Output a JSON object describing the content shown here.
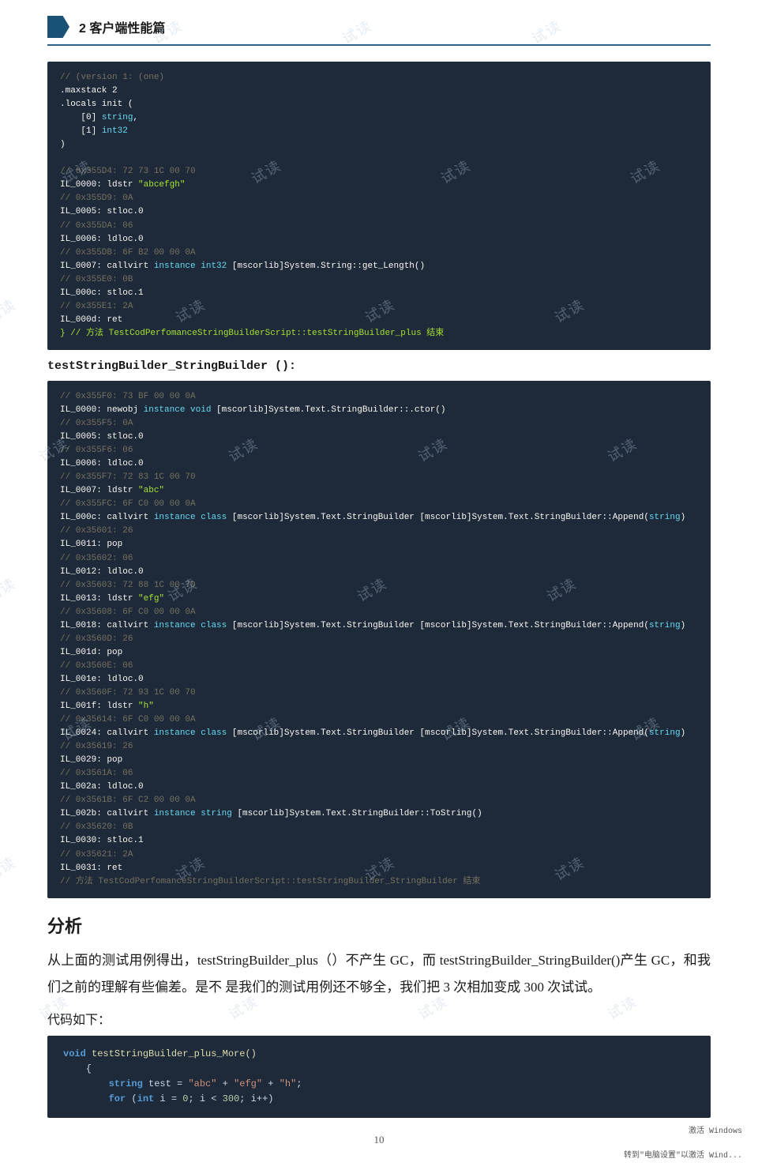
{
  "chapter": {
    "number": "2",
    "title": "2 客户端性能篇"
  },
  "code_block_1": {
    "lines": [
      "// (version 1: (one)",
      ".maxstack 2",
      ".locals init (",
      "    [0] string,",
      "    [1] int32",
      ")",
      "",
      "// 0x355D4: 72 73 1C 00 70",
      "IL_0000: ldstr \"abcefgh\"",
      "// 0x355D9: 0A",
      "IL_0005: stloc.0",
      "// 0x355DA: 06",
      "IL_0006: ldloc.0",
      "// 0x355DB: 6F B2 00 00 0A",
      "IL_0007: callvirt instance int32 [mscorlib]System.String::get_Length()",
      "// 0x355E0: 0B",
      "IL_000c: stloc.1",
      "// 0x355E1: 2A",
      "IL_000d: ret",
      "} // 方法 TestCodPerfomanceStringBuilderScript::testStringBuilder_plus 结束"
    ]
  },
  "method_header_2": "testStringBuilder_StringBuilder ():",
  "code_block_2": {
    "lines": [
      "// 0x355F0: 73 BF 00 00 0A",
      "IL_0000: newobj instance void [mscorlib]System.Text.StringBuilder::.ctor()",
      "// 0x355F5: 0A",
      "IL_0005: stloc.0",
      "// 0x355F6: 06",
      "IL_0006: ldloc.0",
      "// 0x355F7: 72 83 1C 00 70",
      "IL_0007: ldstr \"abc\"",
      "// 0x355FC: 6F C0 00 00 0A",
      "IL_000c: callvirt instance class [mscorlib]System.Text.StringBuilder [mscorlib]System.Text.StringBuilder::Append(string)",
      "// 0x35601: 26",
      "IL_0011: pop",
      "// 0x35602: 06",
      "IL_0012: ldloc.0",
      "// 0x35603: 72 88 1C 00 70",
      "IL_0013: ldstr \"efg\"",
      "// 0x35608: 6F C0 00 00 0A",
      "IL_0018: callvirt instance class [mscorlib]System.Text.StringBuilder [mscorlib]System.Text.StringBuilder::Append(string)",
      "// 0x3560D: 26",
      "IL_001d: pop",
      "// 0x3560E: 06",
      "IL_001e: ldloc.0",
      "// 0x3560F: 72 93 1C 00 70",
      "IL_001f: ldstr \"h\"",
      "// 0x35614: 6F C0 00 00 0A",
      "IL_0024: callvirt instance class [mscorlib]System.Text.StringBuilder [mscorlib]System.Text.StringBuilder::Append(string)",
      "// 0x35619: 26",
      "IL_0029: pop",
      "// 0x3561A: 06",
      "IL_002a: ldloc.0",
      "// 0x3561B: 6F C2 00 00 0A",
      "IL_002b: callvirt instance string [mscorlib]System.Text.StringBuilder::ToString()",
      "// 0x35620: 0B",
      "IL_0030: stloc.1",
      "// 0x35621: 2A",
      "IL_0031: ret",
      "// 方法 TestCodPerfomanceStringBuilderScript::testStringBuilder_StringBuilder 结束"
    ]
  },
  "section_analysis": "分析",
  "analysis_text": "从上面的测试用例得出，testStringBuilder_plus（）不产生 GC，而 testStringBuilder_StringBuilder()产生 GC，和我们之前的理解有些偏差。是不是我们的测试用例还不够全，我们把 3 次相加变成 300 次试试。",
  "label_code": "代码如下：",
  "code_block_3": {
    "keyword_void": "void",
    "func_name": "testStringBuilder_plus_More()",
    "body_lines": [
      "{",
      "        string test = \"abc\" + \"efg\" + \"h\";",
      "        for (int i = 0; i < 300; i++)"
    ]
  },
  "win_activate_line1": "激活 Windows",
  "win_activate_line2": "转到\"电脑设置\"以激活 Wind...",
  "page_number": "10",
  "watermarks": [
    "试读",
    "试读",
    "试读",
    "试读",
    "试读",
    "试读",
    "试读",
    "试读",
    "试读",
    "试读",
    "试读",
    "试读",
    "试读",
    "试读",
    "试读",
    "试读",
    "试读",
    "试读",
    "试读",
    "试读",
    "试读",
    "试读",
    "试读",
    "试读"
  ]
}
